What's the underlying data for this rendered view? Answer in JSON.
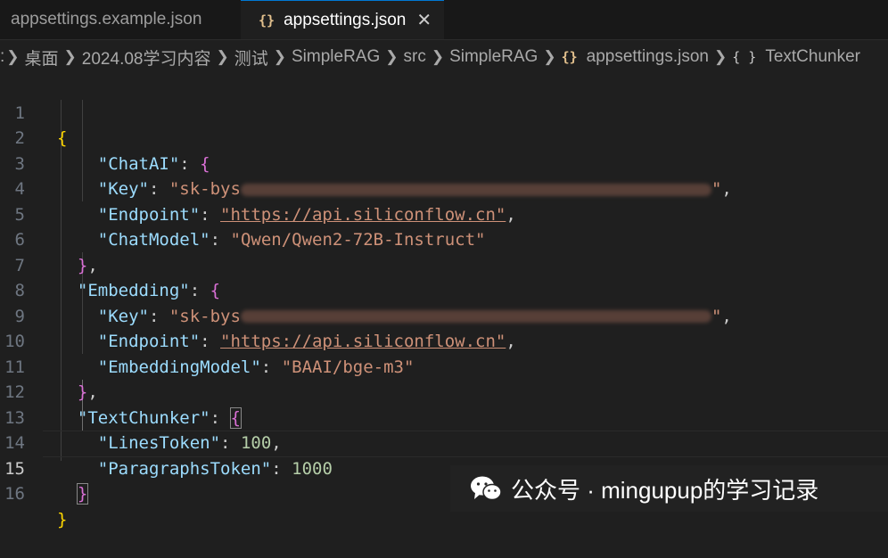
{
  "tabs": [
    {
      "label": "appsettings.example.json",
      "active": false
    },
    {
      "label": "appsettings.json",
      "active": true,
      "icon": "json-braces-icon",
      "close": "✕"
    }
  ],
  "breadcrumb": {
    "prefix": ":",
    "segments": [
      "桌面",
      "2024.08学习内容",
      "测试",
      "SimpleRAG",
      "src",
      "SimpleRAG"
    ],
    "file": "appsettings.json",
    "symbol": "TextChunker",
    "file_icon": "{}",
    "symbol_icon": "{ }"
  },
  "editor": {
    "current_line": 15,
    "line_numbers": [
      "1",
      "2",
      "3",
      "4",
      "5",
      "6",
      "7",
      "8",
      "9",
      "10",
      "11",
      "12",
      "13",
      "14",
      "15",
      "16"
    ],
    "code": {
      "l1_open": "{",
      "chatai_key": "\"ChatAI\"",
      "chatai_open": "{",
      "key_label": "\"Key\"",
      "key1_prefix": "\"sk-bys",
      "key1_suffix": "\"",
      "endpoint_label": "\"Endpoint\"",
      "endpoint_value": "\"https://api.siliconflow.cn\"",
      "chatmodel_label": "\"ChatModel\"",
      "chatmodel_value": "\"Qwen/Qwen2-72B-Instruct\"",
      "close_obj": "}",
      "embedding_key": "\"Embedding\"",
      "embedding_open": "{",
      "key2_prefix": "\"sk-bys",
      "key2_suffix": "\"",
      "embeddingmodel_label": "\"EmbeddingModel\"",
      "embeddingmodel_value": "\"BAAI/bge-m3\"",
      "textchunker_key": "\"TextChunker\"",
      "textchunker_open": "{",
      "linestoken_label": "\"LinesToken\"",
      "linestoken_value": "100",
      "paragraphstoken_label": "\"ParagraphsToken\"",
      "paragraphstoken_value": "1000",
      "l16_close": "}"
    }
  },
  "watermark": {
    "text": "公众号 · mingupup的学习记录",
    "icon": "wechat-icon"
  },
  "colors": {
    "background": "#1f1f1f",
    "key": "#9cdcfe",
    "string": "#ce9178",
    "number": "#b5cea8",
    "bracket_level1": "#ffd700",
    "bracket_level2": "#da70d6",
    "bracket_level3": "#179fff"
  }
}
